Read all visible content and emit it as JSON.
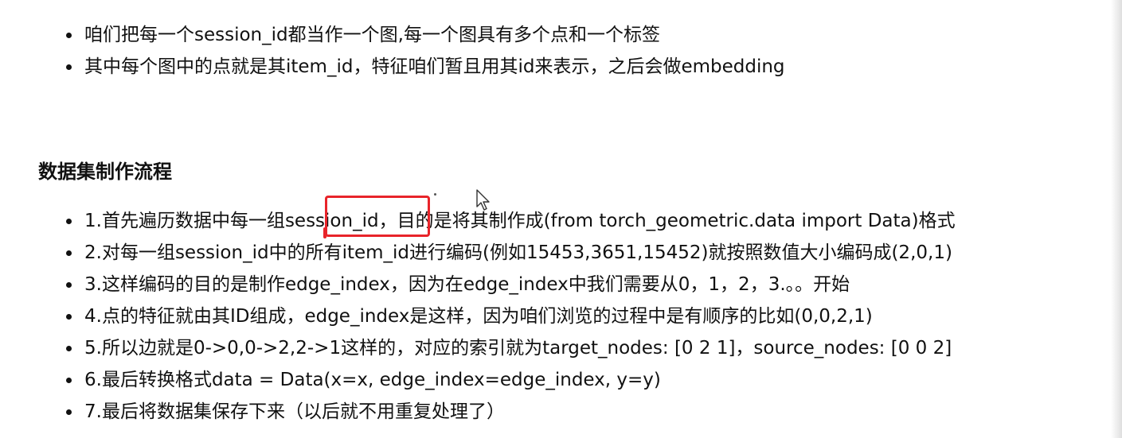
{
  "intro_items": [
    "咱们把每一个session_id都当作一个图,每一个图具有多个点和一个标签",
    "其中每个图中的点就是其item_id，特征咱们暂且用其id来表示，之后会做embedding"
  ],
  "section_heading": "数据集制作流程",
  "steps": [
    "1.首先遍历数据中每一组session_id，目的是将其制作成(from torch_geometric.data import Data)格式",
    "2.对每一组session_id中的所有item_id进行编码(例如15453,3651,15452)就按照数值大小编码成(2,0,1)",
    "3.这样编码的目的是制作edge_index，因为在edge_index中我们需要从0，1，2，3.。。开始",
    "4.点的特征就由其ID组成，edge_index是这样，因为咱们浏览的过程中是有顺序的比如(0,0,2,1)",
    "5.所以边就是0->0,0->2,2->1这样的，对应的索引就为target_nodes: [0 2 1]，source_nodes: [0 0 2]",
    "6.最后转换格式data = Data(x=x, edge_index=edge_index, y=y)",
    "7.最后将数据集保存下来（以后就不用重复处理了）"
  ],
  "annotation": {
    "color": "#e8242a"
  },
  "cursor_icon": "arrow-cursor"
}
